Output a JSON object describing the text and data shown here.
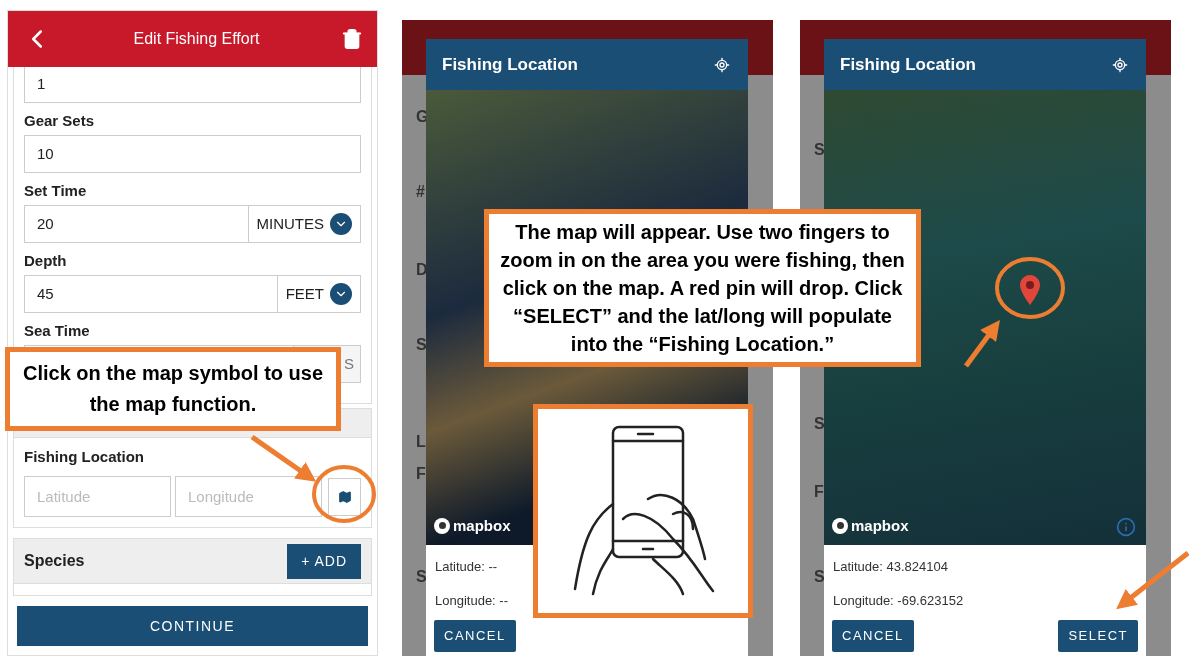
{
  "screens": [
    {
      "kind": "form",
      "title": "Edit Fishing Effort",
      "fields": [
        {
          "value": "1"
        },
        {
          "label": "Gear Sets",
          "value": "10"
        },
        {
          "label": "Set Time",
          "value": "20",
          "unit": "MINUTES",
          "dropdown": true
        },
        {
          "label": "Depth",
          "value": "45",
          "unit": "FEET",
          "dropdown": true
        },
        {
          "label": "Sea Time",
          "unit": "S"
        }
      ],
      "location": {
        "label": "Fishing Location",
        "latitude_placeholder": "Latitude",
        "longitude_placeholder": "Longitude"
      },
      "species": {
        "label": "Species",
        "button": "+ ADD"
      },
      "continue_button": "CONTINUE"
    },
    {
      "kind": "map_dialog",
      "backdrop_letters": [
        "G",
        "#",
        "D",
        "S",
        "L",
        "F",
        "S"
      ],
      "title": "Fishing Location",
      "attribution": "mapbox",
      "pin_dropped": false,
      "info_icon": false,
      "latitude": "Latitude: --",
      "longitude": "Longitude: --",
      "buttons": [
        "CANCEL"
      ]
    },
    {
      "kind": "map_dialog",
      "backdrop_letters": [
        "S",
        "S",
        "F",
        "S"
      ],
      "title": "Fishing Location",
      "attribution": "mapbox",
      "pin_dropped": true,
      "info_icon": true,
      "latitude": "Latitude: 43.824104",
      "longitude": "Longitude: -69.623152",
      "buttons": [
        "CANCEL",
        "SELECT"
      ]
    }
  ],
  "callouts": [
    {
      "text": "Click on the map symbol to use the map function."
    },
    {
      "text": "The map will appear. Use two fingers to zoom in on the area you were fishing, then click on the map. A red pin will drop. Click “SELECT” and the lat/long will populate into the “Fishing Location.”"
    }
  ]
}
